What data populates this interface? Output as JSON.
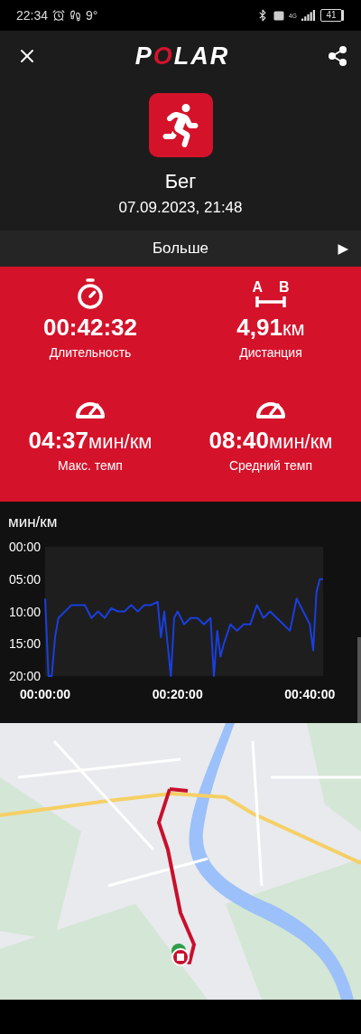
{
  "status_bar": {
    "time": "22:34",
    "temperature": "9°",
    "network": "4G",
    "battery": "41"
  },
  "app_bar": {
    "logo": "POLAR"
  },
  "activity": {
    "kind": "running",
    "title": "Бег",
    "date": "07.09.2023, 21:48"
  },
  "more_row": {
    "label": "Больше",
    "arrow": "▶"
  },
  "distance_icon_letters": [
    "A",
    "B"
  ],
  "stats": [
    {
      "kind": "duration",
      "value": "00:42:32",
      "label": "Длительность"
    },
    {
      "kind": "distance",
      "value": "4,91",
      "unit": "км",
      "label": "Дистанция"
    },
    {
      "kind": "pace",
      "value": "04:37",
      "unit": "мин/км",
      "label": "Макс. темп"
    },
    {
      "kind": "pace",
      "value": "08:40",
      "unit": "мин/км",
      "label": "Средний темп"
    }
  ],
  "pace_chart": {
    "chart_data": {
      "type": "line",
      "ylabel": "мин/км",
      "x": [
        0,
        0.5,
        1,
        1.5,
        2,
        3,
        4,
        5,
        6,
        7,
        8,
        9,
        10,
        11,
        12,
        13,
        14,
        15,
        16,
        17,
        17.5,
        18,
        19,
        19.5,
        20,
        21,
        22,
        23,
        24,
        25,
        25.5,
        26,
        26.5,
        27,
        28,
        29,
        30,
        31,
        32,
        33,
        34,
        35,
        36,
        37,
        38,
        39,
        40,
        40.5,
        41,
        41.5,
        42
      ],
      "series": [
        {
          "color": "#1a3fe0",
          "values": [
            8,
            20,
            20,
            14,
            11,
            10,
            9,
            9,
            9,
            11,
            10,
            11,
            9.5,
            10,
            10,
            9,
            10,
            9,
            9,
            8.5,
            14,
            10,
            20,
            11,
            10,
            12,
            11,
            11,
            12,
            11,
            20,
            13,
            17,
            15,
            12,
            13,
            12,
            12,
            9,
            11,
            10,
            11,
            12,
            13,
            8,
            10,
            12,
            16,
            7,
            5,
            5
          ]
        }
      ],
      "xlim": [
        0,
        42
      ],
      "ylim": [
        20,
        0
      ],
      "xticks": [
        {
          "value": 0,
          "label": "00:00:00"
        },
        {
          "value": 20,
          "label": "00:20:00"
        },
        {
          "value": 40,
          "label": "00:40:00"
        }
      ],
      "yticks": [
        {
          "value": 0,
          "label": "00:00"
        },
        {
          "value": 5,
          "label": "05:00"
        },
        {
          "value": 10,
          "label": "10:00"
        },
        {
          "value": 15,
          "label": "15:00"
        },
        {
          "value": 20,
          "label": "20:00"
        }
      ]
    }
  },
  "map": {
    "kind": "picture"
  }
}
